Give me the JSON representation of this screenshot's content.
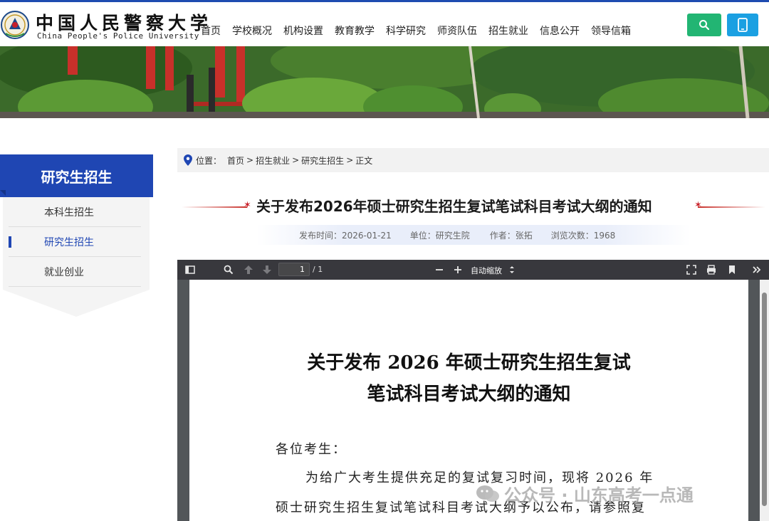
{
  "header": {
    "logo_cn": "中国人民警察大学",
    "logo_en": "China People's Police University",
    "nav": [
      "首页",
      "学校概况",
      "机构设置",
      "教育教学",
      "科学研究",
      "师资队伍",
      "招生就业",
      "信息公开",
      "领导信箱"
    ]
  },
  "sidebar": {
    "title": "研究生招生",
    "items": [
      {
        "label": "本科生招生",
        "active": false
      },
      {
        "label": "研究生招生",
        "active": true
      },
      {
        "label": "就业创业",
        "active": false
      }
    ]
  },
  "breadcrumb": {
    "prefix": "位置：",
    "items": [
      "首页",
      "招生就业",
      "研究生招生",
      "正文"
    ],
    "separator": ">"
  },
  "article": {
    "title": "关于发布2026年硕士研究生招生复试笔试科目考试大纲的通知",
    "meta": {
      "publish": "发布时间：2026-01-21",
      "unit": "单位：研究生院",
      "author": "作者：张拓",
      "views": "浏览次数：1968"
    }
  },
  "pdf_viewer": {
    "page_current": "1",
    "page_total": "/ 1",
    "zoom": "自动缩放",
    "doc": {
      "title_line1": "关于发布 2026 年硕士研究生招生复试",
      "title_line2": "笔试科目考试大纲的通知",
      "salutation": "各位考生：",
      "para_line1": "为给广大考生提供充足的复试复习时间，现将 2026 年",
      "para_line2": "硕士研究生招生复试笔试科目考试大纲予以公布，请参照复"
    }
  },
  "watermark": {
    "text": "公众号 · 山东高考一点通"
  },
  "colors": {
    "brand_blue": "#1f46b3",
    "search_green": "#22b573",
    "mobile_blue": "#1ba0e2",
    "title_red": "#c8202a"
  }
}
